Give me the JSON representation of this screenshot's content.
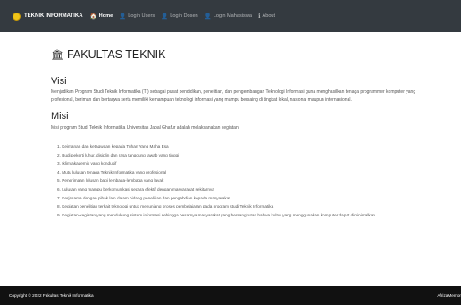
{
  "navbar": {
    "brand": "TEKNIK INFORMATIKA",
    "items": [
      {
        "label": "Home",
        "icon": "home-icon",
        "glyph": "🏠",
        "active": true
      },
      {
        "label": "Login Users",
        "icon": "user-icon",
        "glyph": "👤",
        "active": false
      },
      {
        "label": "Login Dosen",
        "icon": "user-icon",
        "glyph": "👤",
        "active": false
      },
      {
        "label": "Login Mahasiswa",
        "icon": "user-icon",
        "glyph": "👤",
        "active": false
      },
      {
        "label": "About",
        "icon": "info-icon",
        "glyph": "ℹ",
        "active": false
      }
    ]
  },
  "main": {
    "title": "FAKULTAS TEKNIK",
    "title_icon_glyph": "🏛",
    "visi": {
      "heading": "Visi",
      "text": "Menjadikan Program Studi Teknik Informatika (TI) sebagai pusat pendidikan, penelitian, dan pengembangan Teknologi Informasi guna menghasilkan tenaga programmer komputer yang profesional, beriman dan bertaqwa serta memiliki kemampuan teknologi informasi yang mampu bersaing di tingkat lokal, nasional maupun internasional."
    },
    "misi": {
      "heading": "Misi",
      "intro": "Misi program Studi Teknik Informatika Universitas Jabal Ghafur adalah melaksanakan kegiatan:",
      "items": [
        "1. Keimanan dan ketaqwaan kepada Tuhan Yang Maha Esa",
        "2. Budi pekerti luhur, disiplin dan rasa tanggung jawab yang tinggi",
        "3. Iklim akademik yang kondusif",
        "4. Mutu lulusan tenaga Teknik Informatika yang profesional",
        "5. Penerimaan lulusan bagi lembaga-lembaga yang layak",
        "6. Lulusan yang mampu berkomunikasi secara efektif dengan masyarakat sekitarnya",
        "7. Kerjasama dengan pihak lain dalam bidang penelitian dan pengabdian kepada masyarakat",
        "8. Kegiatan penelitian terkait teknologi untuk menunjang proses pembelajaran pada program studi Teknik Informatika",
        "9. Kegiatan-kegiatan yang mendukung sistem informasi sehingga besarnya masyarakat yang bersangkutan bahwa kultur yang menggunakan komputer dapat diminimalkan"
      ]
    }
  },
  "footer": {
    "copyright": "Copyright © 2022 Fakultas Teknik Informatika",
    "right": "AfrizaMemor"
  }
}
